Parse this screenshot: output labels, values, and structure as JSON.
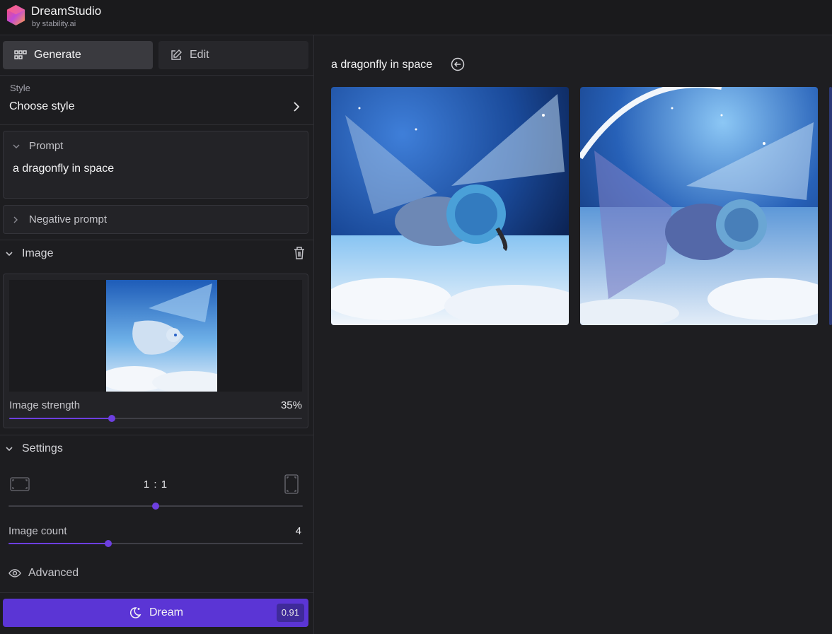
{
  "app": {
    "name": "DreamStudio",
    "byline": "by stability.ai"
  },
  "tabs": {
    "generate": "Generate",
    "edit": "Edit"
  },
  "style": {
    "label": "Style",
    "value": "Choose style"
  },
  "prompt": {
    "label": "Prompt",
    "text": "a dragonfly in space"
  },
  "negative_prompt": {
    "label": "Negative prompt"
  },
  "image_section": {
    "label": "Image",
    "strength_label": "Image strength",
    "strength_value": "35%",
    "strength_fraction": 0.35
  },
  "settings": {
    "label": "Settings",
    "aspect_ratio": "1 : 1",
    "aspect_fraction": 0.5,
    "image_count_label": "Image count",
    "image_count_value": "4",
    "image_count_fraction": 0.34,
    "advanced_label": "Advanced"
  },
  "dream_button": {
    "label": "Dream",
    "credits": "0.91"
  },
  "results": {
    "prompt": "a dragonfly in space"
  },
  "colors": {
    "accent": "#5b35d5",
    "slider": "#6d3fe0",
    "background": "#1d1d20"
  },
  "icons": [
    "grid-icon",
    "edit-icon",
    "chevron-right-icon",
    "chevron-down-icon",
    "trash-icon",
    "landscape-icon",
    "portrait-icon",
    "eye-icon",
    "moon-icon",
    "back-arrow-icon"
  ]
}
